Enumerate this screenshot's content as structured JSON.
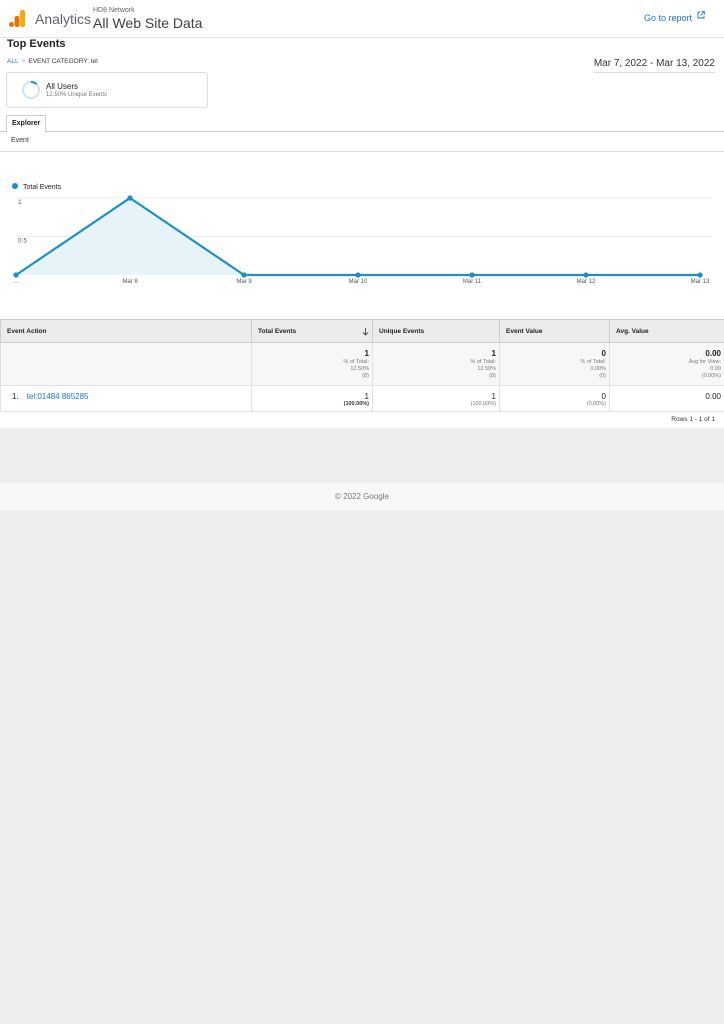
{
  "header": {
    "brand": "Analytics",
    "account": "HD8 Network",
    "property": "All Web Site Data",
    "goto_report": "Go to report"
  },
  "report": {
    "title": "Top Events",
    "breadcrumb_all": "ALL",
    "breadcrumb_separator": ">",
    "breadcrumb_filter": "EVENT CATEGORY: tel",
    "date_range": "Mar 7, 2022 - Mar 13, 2022"
  },
  "segment": {
    "name": "All Users",
    "subtitle": "12.50% Unique Events",
    "ring_fraction": 0.125
  },
  "tabs": {
    "explorer": "Explorer",
    "subtab": "Event"
  },
  "chart_data": {
    "type": "line",
    "series": [
      {
        "name": "Total Events",
        "values": [
          0,
          1,
          0,
          0,
          0,
          0,
          0
        ]
      }
    ],
    "categories": [
      "…",
      "Mar 8",
      "Mar 9",
      "Mar 10",
      "Mar 11",
      "Mar 12",
      "Mar 13"
    ],
    "yticks": [
      "1",
      "0.5"
    ],
    "ylim": [
      0,
      1
    ],
    "color": "#1c8fc4",
    "fill": "#e6f3f8"
  },
  "table": {
    "columns": [
      "Event Action",
      "Total Events",
      "Unique Events",
      "Event Value",
      "Avg. Value"
    ],
    "summary": {
      "total_events": {
        "value": "1",
        "label": "% of Total:",
        "pct": "12.50%",
        "base": "(8)"
      },
      "unique_events": {
        "value": "1",
        "label": "% of Total:",
        "pct": "12.50%",
        "base": "(8)"
      },
      "event_value": {
        "value": "0",
        "label": "% of Total:",
        "pct": "0.00%",
        "base": "(0)"
      },
      "avg_value": {
        "value": "0.00",
        "label": "Avg for View:",
        "pct": "0.00",
        "base": "(0.00%)"
      }
    },
    "rows": [
      {
        "index": "1.",
        "action": "tel:01484 865285",
        "total_events": "1",
        "total_events_pct": "(100.00%)",
        "unique_events": "1",
        "unique_events_pct": "(100.00%)",
        "event_value": "0",
        "event_value_pct": "(0.00%)",
        "avg_value": "0.00"
      }
    ],
    "pager": "Rows 1 - 1 of 1"
  },
  "footer": {
    "copyright": "© 2022 Google"
  }
}
